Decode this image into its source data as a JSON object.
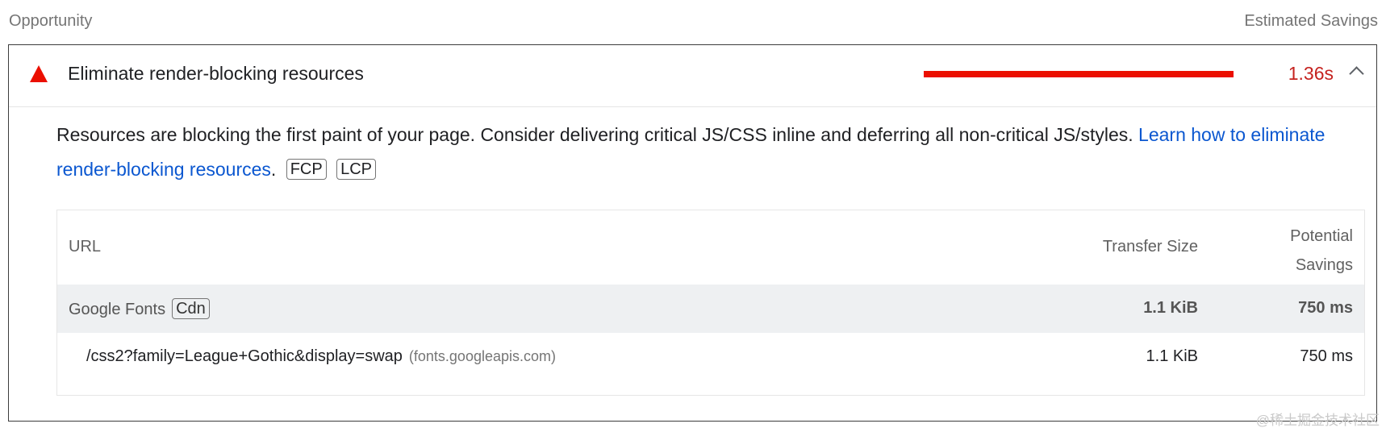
{
  "header": {
    "left_label": "Opportunity",
    "right_label": "Estimated Savings"
  },
  "audit": {
    "icon": "fail-triangle-icon",
    "title": "Eliminate render-blocking resources",
    "savings_display": "1.36s",
    "savings_bar_fraction": 1.0,
    "expanded": true,
    "description_text": "Resources are blocking the first paint of your page. Consider delivering critical JS/CSS inline and deferring all non-critical JS/styles. ",
    "learn_link": "Learn how to eliminate render-blocking resources",
    "description_end": ".",
    "tags": [
      "FCP",
      "LCP"
    ]
  },
  "table": {
    "headers": {
      "url": "URL",
      "transfer_size": "Transfer Size",
      "potential_savings_line1": "Potential",
      "potential_savings_line2": "Savings"
    },
    "group": {
      "name": "Google Fonts",
      "tag": "Cdn",
      "transfer_size": "1.1 KiB",
      "savings": "750 ms"
    },
    "rows": [
      {
        "url": "/css2?family=League+Gothic&display=swap",
        "host": "(fonts.googleapis.com)",
        "transfer_size": "1.1 KiB",
        "savings": "750 ms"
      }
    ]
  },
  "watermark": "@稀土掘金技术社区",
  "colors": {
    "fail": "#eb0f00",
    "savings_text": "#c5221f",
    "link": "#0b57d0",
    "group_row_bg": "#eef0f2"
  }
}
